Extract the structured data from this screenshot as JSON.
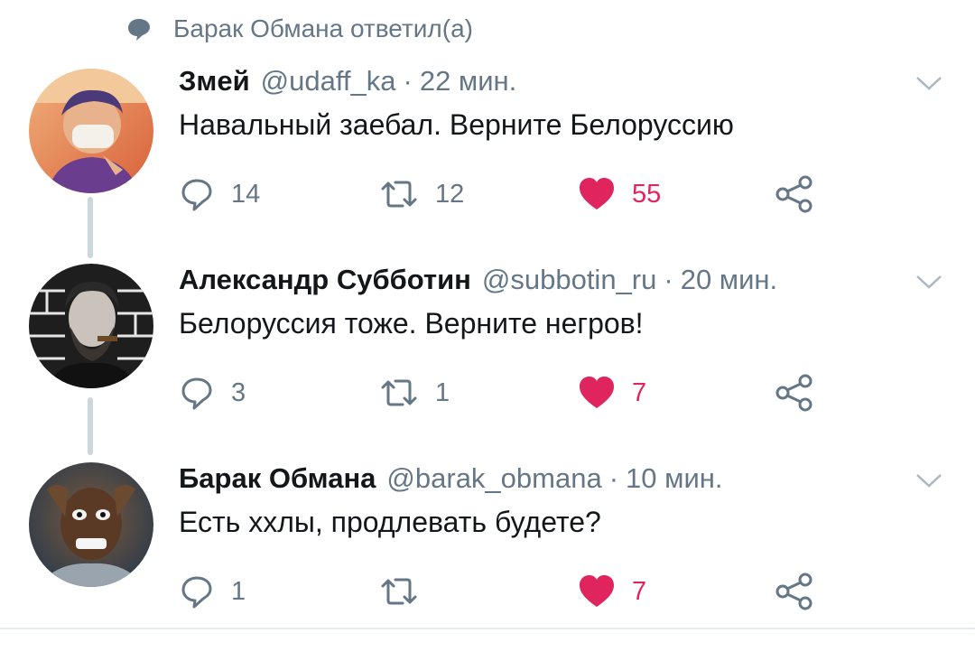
{
  "reply_context": {
    "text": "Барак Обмана ответил(а)"
  },
  "tweets": [
    {
      "name": "Змей",
      "handle": "@udaff_ka",
      "separator": "·",
      "time": "22 мин.",
      "text": "Навальный заебал. Верните Белоруссию",
      "replies": "14",
      "retweets": "12",
      "likes": "55",
      "liked": true
    },
    {
      "name": "Александр Субботин",
      "handle": "@subbotin_ru",
      "separator": "·",
      "time": "20 мин.",
      "text": "Белоруссия тоже. Верните негров!",
      "replies": "3",
      "retweets": "1",
      "likes": "7",
      "liked": true
    },
    {
      "name": "Барак Обмана",
      "handle": "@barak_obmana",
      "separator": "·",
      "time": "10 мин.",
      "text": "Есть ххлы, продлевать будете?",
      "replies": "1",
      "retweets": "",
      "likes": "7",
      "liked": true
    }
  ],
  "colors": {
    "like": "#e0245e",
    "muted": "#657786",
    "thread_line": "#ccd6dd"
  },
  "icons": [
    "reply-icon",
    "retweet-icon",
    "heart-icon",
    "share-icon",
    "chevron-down-icon",
    "comment-bubble-icon"
  ]
}
